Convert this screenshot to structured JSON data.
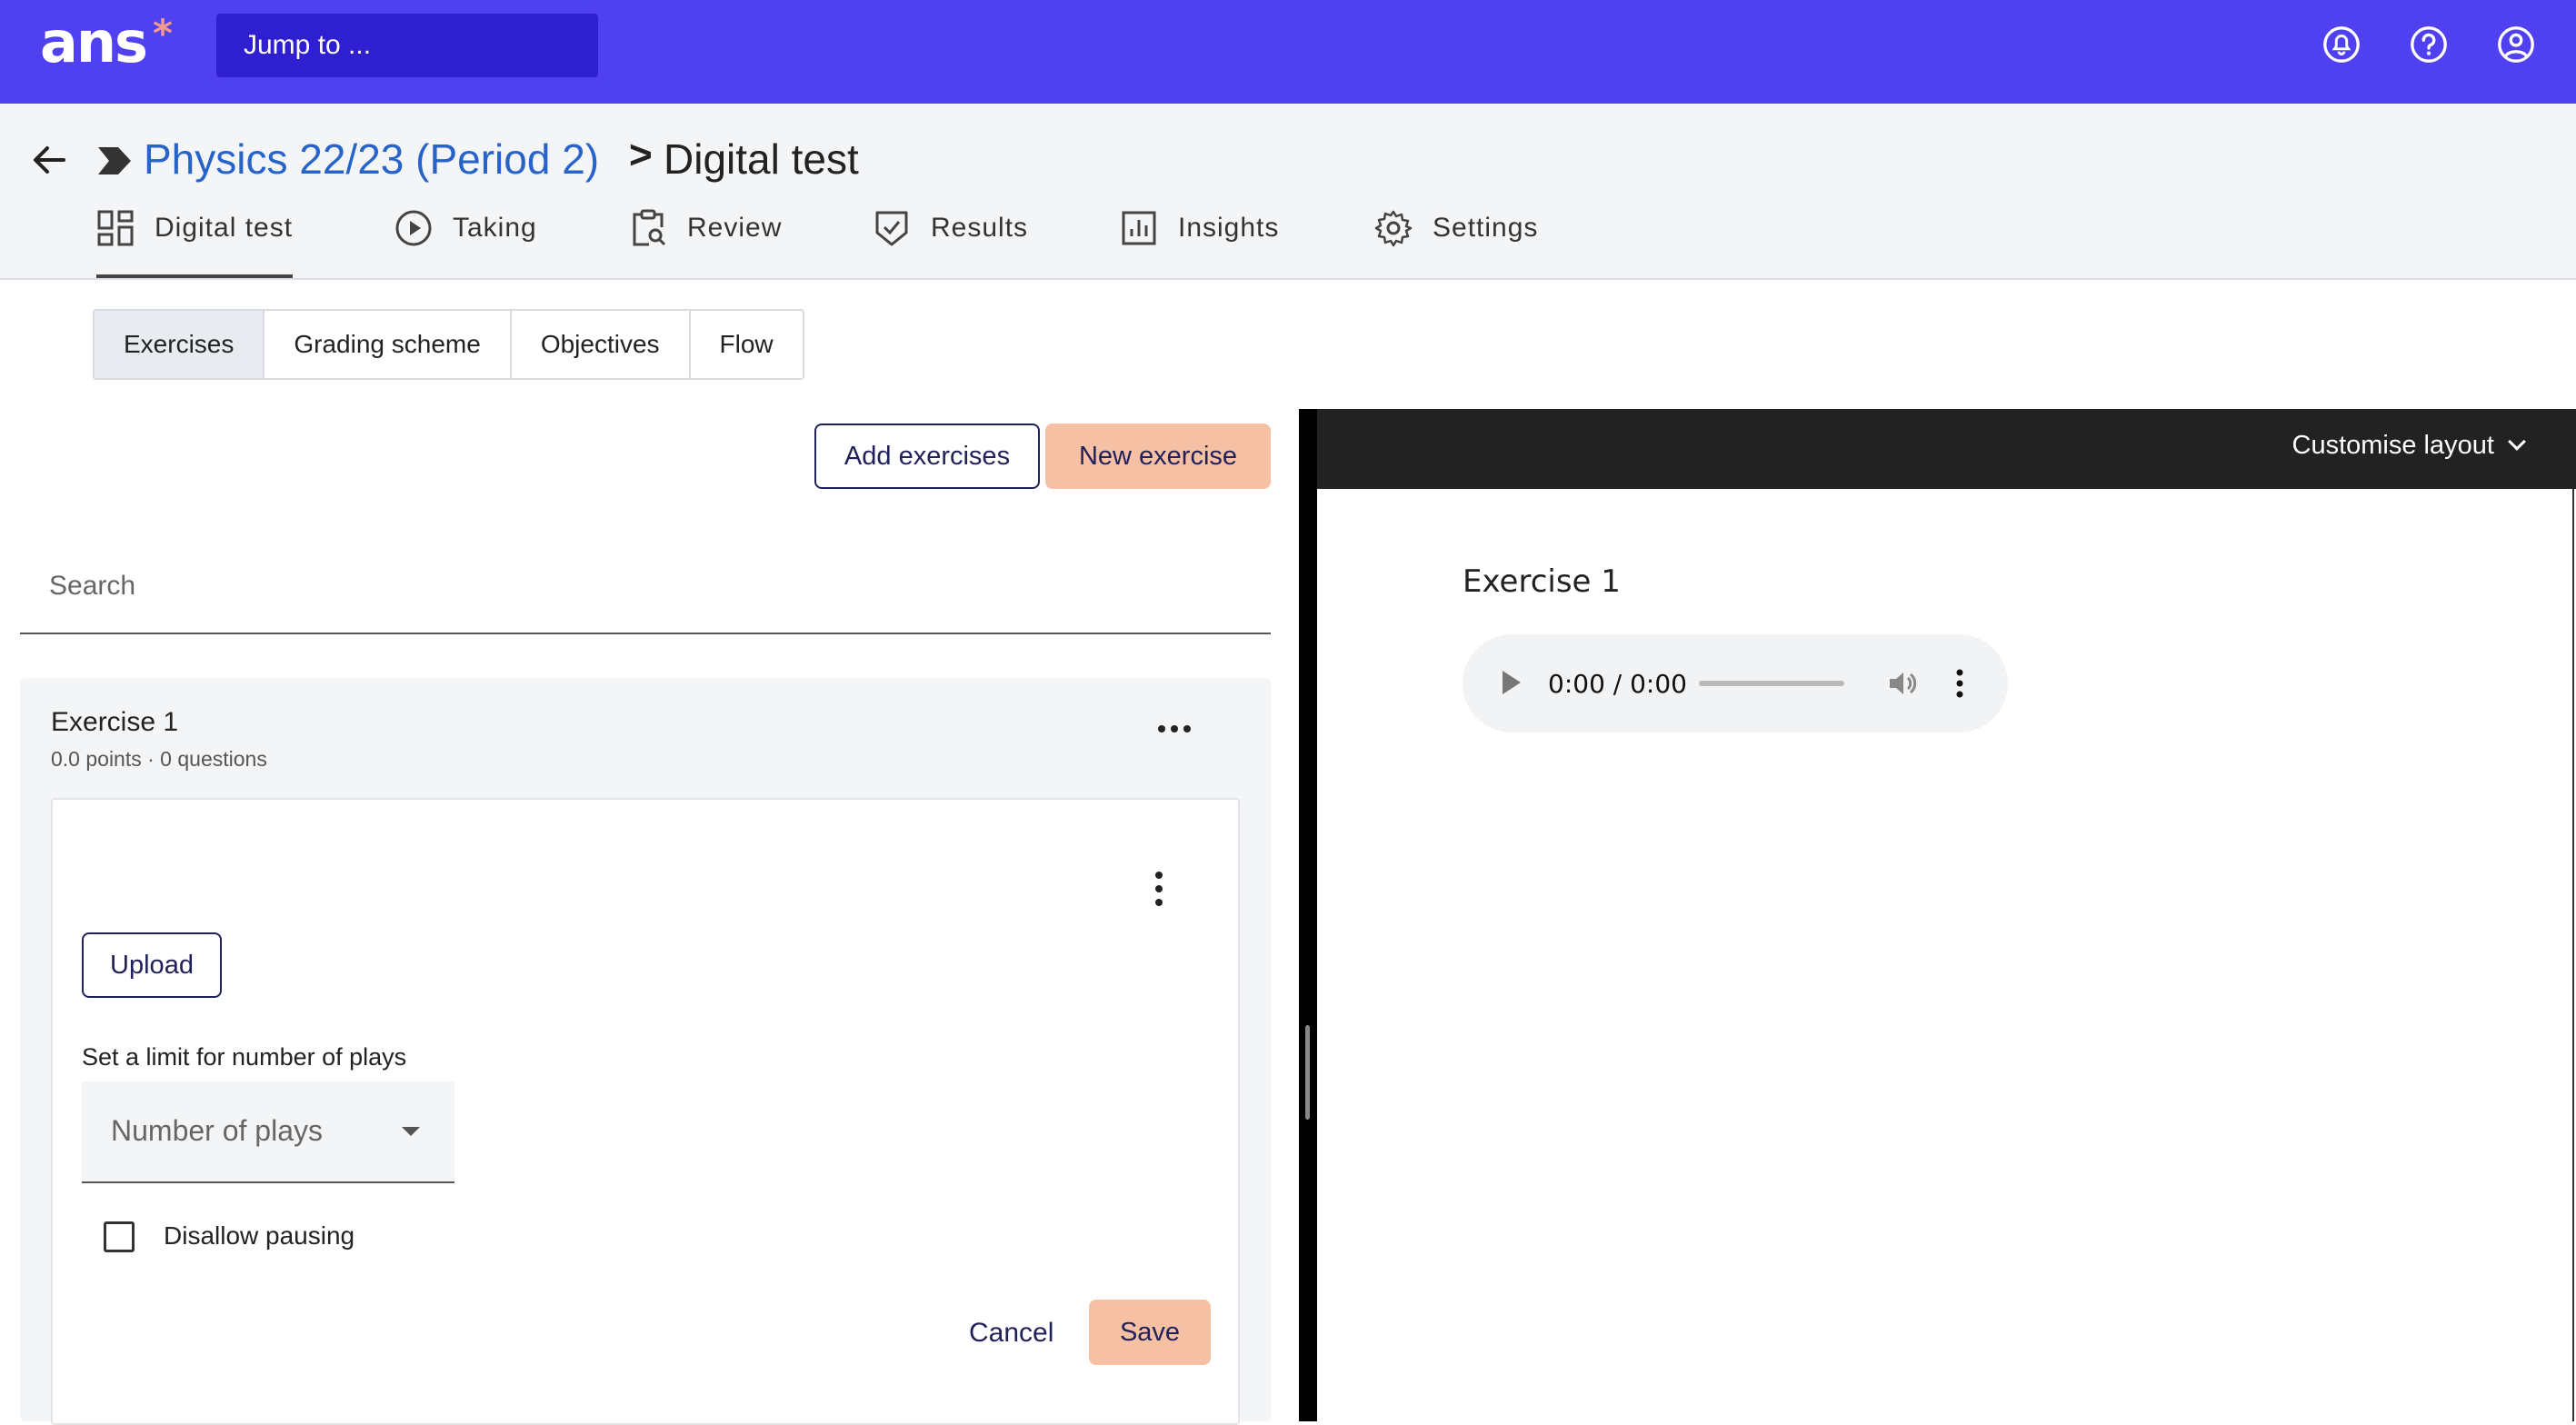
{
  "topbar": {
    "logo": "ans",
    "logo_star": "*",
    "jump_placeholder": "Jump to ...",
    "icons": [
      "notifications-icon",
      "help-icon",
      "account-icon"
    ]
  },
  "header": {
    "breadcrumb_link": "Physics 22/23 (Period 2)",
    "breadcrumb_sep": ">",
    "breadcrumb_current": "Digital test",
    "tabs": [
      {
        "label": "Digital test",
        "icon": "dashboard-icon",
        "active": true
      },
      {
        "label": "Taking",
        "icon": "play-circle-icon",
        "active": false
      },
      {
        "label": "Review",
        "icon": "clipboard-search-icon",
        "active": false
      },
      {
        "label": "Results",
        "icon": "shield-check-icon",
        "active": false
      },
      {
        "label": "Insights",
        "icon": "bar-chart-icon",
        "active": false
      },
      {
        "label": "Settings",
        "icon": "gear-icon",
        "active": false
      }
    ]
  },
  "subtabs": [
    "Exercises",
    "Grading scheme",
    "Objectives",
    "Flow"
  ],
  "toolbar": {
    "add_exercises": "Add exercises",
    "new_exercise": "New exercise"
  },
  "search": {
    "placeholder": "Search"
  },
  "exercise_card": {
    "title": "Exercise 1",
    "subtitle": "0.0 points · 0 questions",
    "upload": "Upload",
    "limit_label": "Set a limit for number of plays",
    "plays_placeholder": "Number of plays",
    "disallow_pausing": "Disallow pausing",
    "cancel": "Cancel",
    "save": "Save"
  },
  "preview": {
    "customise": "Customise layout",
    "title": "Exercise 1",
    "audio_time": "0:00 / 0:00"
  },
  "colors": {
    "brand": "#4f41f0",
    "jump_bg": "#2e1fd0",
    "link": "#2864c8",
    "peach": "#f5c0a3",
    "navy": "#22205a"
  }
}
